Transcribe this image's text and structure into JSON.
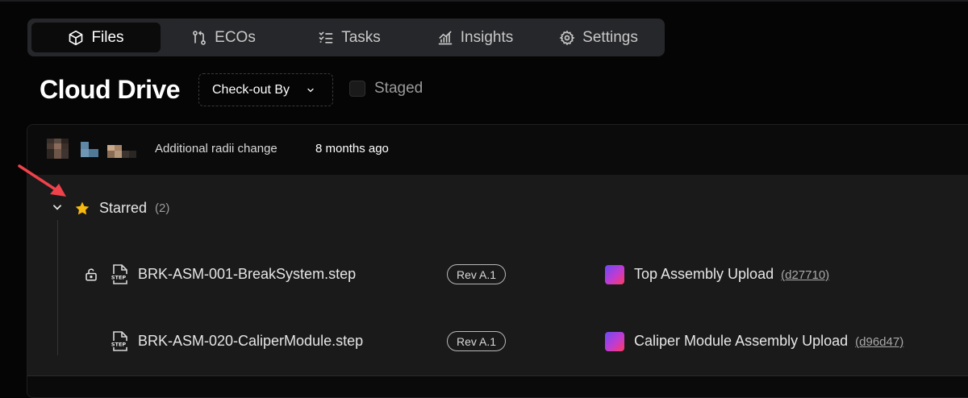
{
  "tabs": [
    {
      "label": "Files",
      "icon": "box-icon",
      "active": true
    },
    {
      "label": "ECOs",
      "icon": "git-compare-icon",
      "active": false
    },
    {
      "label": "Tasks",
      "icon": "task-list-icon",
      "active": false
    },
    {
      "label": "Insights",
      "icon": "bar-chart-icon",
      "active": false
    },
    {
      "label": "Settings",
      "icon": "gear-icon",
      "active": false
    }
  ],
  "page": {
    "title": "Cloud Drive",
    "dropdown_label": "Check-out By",
    "staged_label": "Staged"
  },
  "commit": {
    "message": "Additional radii change",
    "time": "8 months ago"
  },
  "starred": {
    "label": "Starred",
    "count": "(2)"
  },
  "files": [
    {
      "name": "BRK-ASM-001-BreakSystem.step",
      "revision": "Rev A.1",
      "upload_title": "Top Assembly Upload",
      "upload_hash": "(d27710)",
      "unlocked": true
    },
    {
      "name": "BRK-ASM-020-CaliperModule.step",
      "revision": "Rev A.1",
      "upload_title": "Caliper Module Assembly Upload",
      "upload_hash": "(d96d47)",
      "unlocked": false
    }
  ],
  "colors": {
    "background": "#050505",
    "tab_bar": "#26272a",
    "row_bg": "#1a1a1b",
    "star": "#f5b90f",
    "arrow": "#f0424a",
    "gradient_from": "#6b4bf5",
    "gradient_to": "#ff3b5c"
  }
}
